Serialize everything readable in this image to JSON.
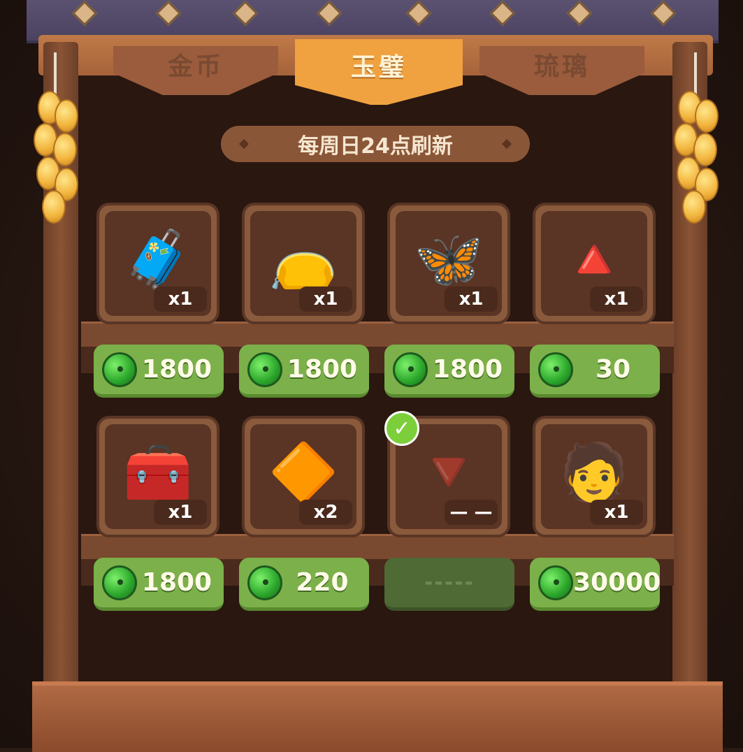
{
  "tabs": {
    "coin": "金币",
    "jade": "玉璧",
    "glaze": "琉璃",
    "active": "jade"
  },
  "refresh_text": "每周日24点刷新",
  "currency_icon": "jade-disc-icon",
  "items": [
    {
      "icon": "pillow-icon",
      "glyph": "🧳",
      "qty": "x1",
      "price": "1800"
    },
    {
      "icon": "pouch-icon",
      "glyph": "👝",
      "qty": "x1",
      "price": "1800"
    },
    {
      "icon": "butterfly-ornament-icon",
      "glyph": "🦋",
      "qty": "x1",
      "price": "1800"
    },
    {
      "icon": "rice-cake-bronze-icon",
      "glyph": "🔺",
      "qty": "x1",
      "price": "30"
    },
    {
      "icon": "treasure-chest-icon",
      "glyph": "🧰",
      "qty": "x1",
      "price": "1800"
    },
    {
      "icon": "rice-cake-gold-icon",
      "glyph": "🔶",
      "qty": "x2",
      "price": "220"
    },
    {
      "icon": "rice-cake-soldout-icon",
      "glyph": "🔻",
      "qty": "— —",
      "price": "-----",
      "sold": true
    },
    {
      "icon": "character-avatar-icon",
      "glyph": "🧑",
      "qty": "x1",
      "price": "30000"
    }
  ],
  "colors": {
    "price_button": "#7cb04a",
    "tab_active": "#f0a240",
    "tab_inactive": "#9a5c3c"
  }
}
